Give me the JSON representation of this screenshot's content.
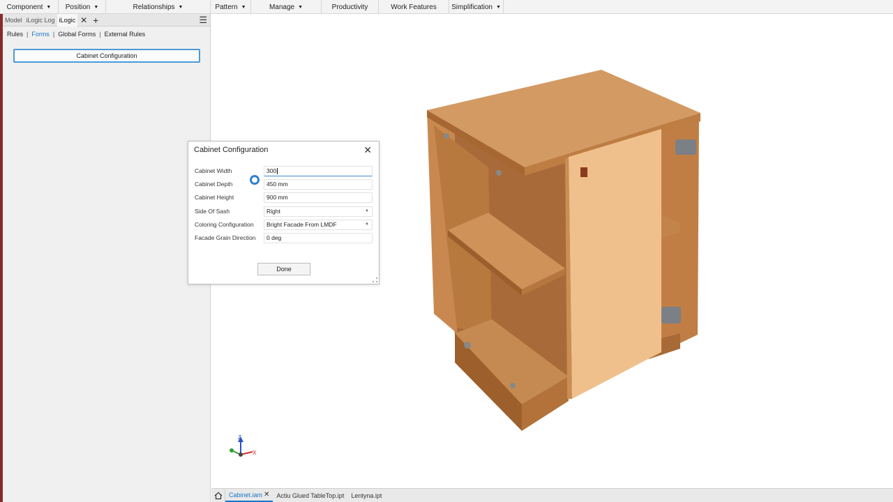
{
  "ribbon": {
    "items": [
      {
        "label": "Component",
        "has_menu": true
      },
      {
        "label": "Position",
        "has_menu": true
      },
      {
        "label": "Relationships",
        "has_menu": true
      },
      {
        "label": "Pattern",
        "has_menu": true
      },
      {
        "label": "Manage",
        "has_menu": true
      },
      {
        "label": "Productivity",
        "has_menu": false
      },
      {
        "label": "Work Features",
        "has_menu": false
      },
      {
        "label": "Simplification",
        "has_menu": true
      }
    ]
  },
  "left_panel": {
    "tabs": [
      "Model",
      "iLogic Log",
      "iLogic"
    ],
    "active_tab": "iLogic",
    "subtabs": [
      "Rules",
      "Forms",
      "Global Forms",
      "External Rules"
    ],
    "active_subtab": "Forms",
    "form_button_label": "Cabinet Configuration"
  },
  "dialog": {
    "title": "Cabinet Configuration",
    "params": [
      {
        "label": "Cabinet Width",
        "value": "300",
        "type": "text",
        "focused": true
      },
      {
        "label": "Cabinet Depth",
        "value": "450 mm",
        "type": "text"
      },
      {
        "label": "Cabinet Height",
        "value": "900 mm",
        "type": "text"
      },
      {
        "label": "Side Of Sash",
        "value": "Right",
        "type": "dropdown"
      },
      {
        "label": "Coloring Configuration",
        "value": "Bright Facade From LMDF",
        "type": "dropdown"
      },
      {
        "label": "Facade Grain Direction",
        "value": "0 deg",
        "type": "text"
      }
    ],
    "done_label": "Done"
  },
  "doc_tabs": {
    "items": [
      "Cabinet.iam",
      "Actiu  Glued TableTop.ipt",
      "Lentyna.ipt"
    ],
    "active": "Cabinet.iam"
  },
  "colors": {
    "accent": "#1a73c8",
    "wood_top": "#d39a64",
    "wood_side": "#b97842",
    "wood_dark": "#8e5a2e",
    "facade": "#f0c08c"
  },
  "triad": {
    "labels": [
      "Z",
      "X"
    ]
  }
}
